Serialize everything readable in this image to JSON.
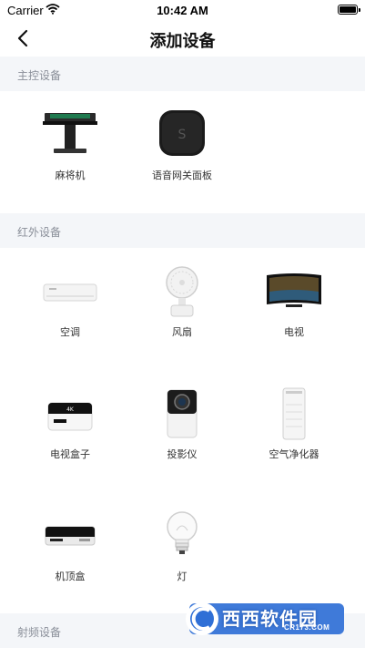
{
  "status": {
    "carrier": "Carrier",
    "time": "10:42 AM"
  },
  "nav": {
    "title": "添加设备",
    "back_icon": "chevron-left-icon"
  },
  "sections": {
    "main": {
      "title": "主控设备"
    },
    "ir": {
      "title": "红外设备"
    },
    "rf": {
      "title": "射频设备"
    }
  },
  "devices": {
    "mahjong": "麻将机",
    "voice_panel": "语音网关面板",
    "ac": "空调",
    "fan": "风扇",
    "tv": "电视",
    "tv_box": "电视盒子",
    "projector": "投影仪",
    "purifier": "空气净化器",
    "settop": "机顶盒",
    "lamp": "灯"
  },
  "watermark": {
    "text": "西西软件园",
    "sub": "CR173.COM"
  }
}
